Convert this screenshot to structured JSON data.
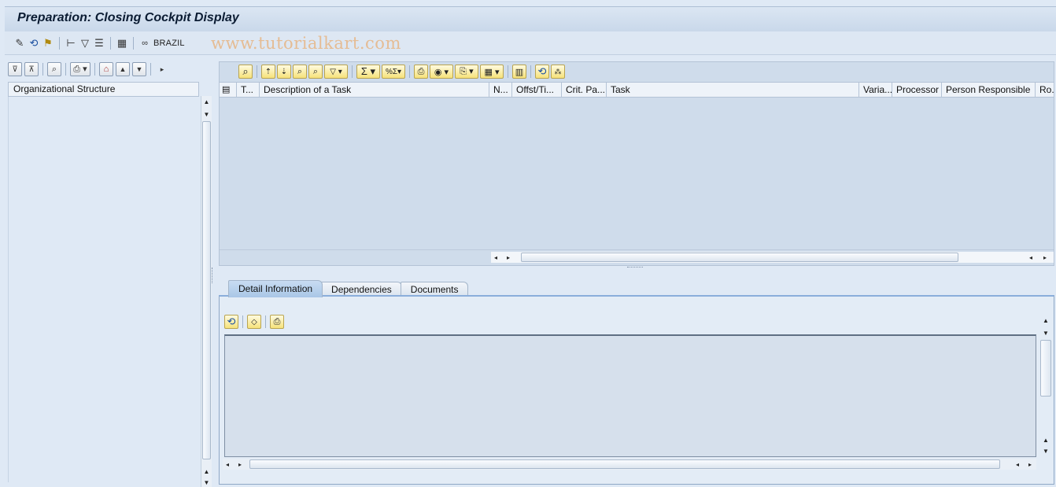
{
  "window": {
    "title": "Preparation: Closing Cockpit Display"
  },
  "app_toolbar": {
    "items": [
      {
        "name": "edit-icon",
        "glyph": "✎"
      },
      {
        "name": "refresh-icon",
        "glyph": "⟲"
      },
      {
        "name": "legend-icon",
        "glyph": "⚑"
      },
      {
        "name": "structure-icon",
        "glyph": "⊢"
      },
      {
        "name": "filter-icon",
        "glyph": "▽"
      },
      {
        "name": "list-icon",
        "glyph": "☰"
      },
      {
        "name": "layout-icon",
        "glyph": "▦"
      }
    ],
    "brazil_label": "BRAZIL",
    "watermark": "www.tutorialkart.com"
  },
  "left_pane": {
    "header": "Organizational Structure"
  },
  "grid": {
    "columns": [
      "T...",
      "Description of a Task",
      "N...",
      "Offst/Ti...",
      "Crit. Pa...",
      "Task",
      "Varia...",
      "Processor",
      "Person Responsible",
      "Ro..."
    ]
  },
  "tabs": {
    "items": [
      "Detail Information",
      "Dependencies",
      "Documents"
    ],
    "active": "Detail Information"
  }
}
